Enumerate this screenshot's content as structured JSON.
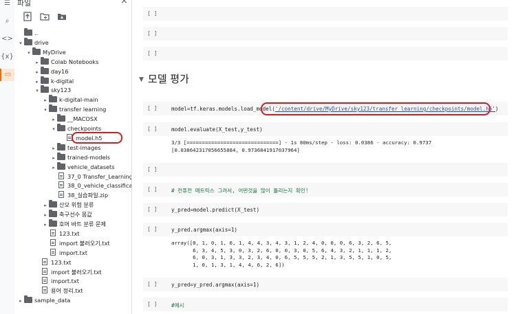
{
  "panel": {
    "title": "파일",
    "close_glyph": "×",
    "toolbar": [
      "upload-file-icon",
      "new-folder-icon",
      "mount-drive-icon"
    ]
  },
  "rail": {
    "icons": [
      {
        "name": "menu-icon",
        "glyph": "☰"
      },
      {
        "name": "search-icon",
        "glyph": "⌕"
      },
      {
        "name": "code-icon",
        "glyph": "<>"
      },
      {
        "name": "variables-icon",
        "glyph": "{x}"
      },
      {
        "name": "files-icon",
        "glyph": "▭"
      }
    ]
  },
  "tree": [
    {
      "label": "..",
      "depth": 0,
      "kind": "up"
    },
    {
      "label": "drive",
      "depth": 0,
      "kind": "folder",
      "open": true
    },
    {
      "label": "MyDrive",
      "depth": 1,
      "kind": "folder",
      "open": true
    },
    {
      "label": "Colab Notebooks",
      "depth": 2,
      "kind": "folder",
      "open": false
    },
    {
      "label": "day16",
      "depth": 2,
      "kind": "folder",
      "open": false
    },
    {
      "label": "k-digital",
      "depth": 2,
      "kind": "folder",
      "open": false
    },
    {
      "label": "sky123",
      "depth": 2,
      "kind": "folder",
      "open": true
    },
    {
      "label": "k-digital-main",
      "depth": 3,
      "kind": "folder",
      "open": false
    },
    {
      "label": "transfer learning",
      "depth": 3,
      "kind": "folder",
      "open": true
    },
    {
      "label": "__MACOSX",
      "depth": 4,
      "kind": "folder",
      "open": false
    },
    {
      "label": "checkpoints",
      "depth": 4,
      "kind": "folder",
      "open": true
    },
    {
      "label": "model.h5",
      "depth": 5,
      "kind": "file"
    },
    {
      "label": "test-images",
      "depth": 4,
      "kind": "folder",
      "open": false
    },
    {
      "label": "trained-models",
      "depth": 4,
      "kind": "folder",
      "open": false
    },
    {
      "label": "vehicle_datasets",
      "depth": 4,
      "kind": "folder",
      "open": false
    },
    {
      "label": "37_0 Transfer_Learning...",
      "depth": 4,
      "kind": "file"
    },
    {
      "label": "38_0_vehicle_classifica...",
      "depth": 4,
      "kind": "file"
    },
    {
      "label": "38_실습파일.zip",
      "depth": 4,
      "kind": "file"
    },
    {
      "label": "산모 위험 분류",
      "depth": 3,
      "kind": "folder",
      "open": false
    },
    {
      "label": "축구선수 몸값",
      "depth": 3,
      "kind": "folder",
      "open": false
    },
    {
      "label": "호머 바트 분류 문제",
      "depth": 3,
      "kind": "folder",
      "open": false
    },
    {
      "label": "123.txt",
      "depth": 3,
      "kind": "file"
    },
    {
      "label": "import 불러오기.txt",
      "depth": 3,
      "kind": "file"
    },
    {
      "label": "import.txt",
      "depth": 3,
      "kind": "file"
    },
    {
      "label": "123.txt",
      "depth": 2,
      "kind": "file"
    },
    {
      "label": "import 불러오기.txt",
      "depth": 2,
      "kind": "file"
    },
    {
      "label": "import.txt",
      "depth": 2,
      "kind": "file"
    },
    {
      "label": "용어 정리.txt",
      "depth": 2,
      "kind": "file"
    },
    {
      "label": "sample_data",
      "depth": 0,
      "kind": "folder",
      "open": false
    }
  ],
  "notebook": {
    "section_title": "모델 평가",
    "bracket": "[ ]",
    "cells": [
      {
        "code": "",
        "output": ""
      },
      {
        "code": "",
        "output": ""
      },
      {
        "code": "",
        "output": ""
      },
      {
        "code_prefix": "model=tf.keras.models.load_model(",
        "code_path": "'/content/drive/MyDrive/sky123/transfer learning/checkpoints/model.h5'",
        "code_suffix": ")",
        "output": ""
      },
      {
        "code": "model.evaluate(X_test,y_test)",
        "output": "3/3 [==============================] - 1s 80ms/step - loss: 0.0386 - accuracy: 0.9737\n[0.038642317056655884, 0.9736841917037964]"
      },
      {
        "code": "",
        "output": ""
      },
      {
        "code": "# 컨퓨전 매트릭스 그려서, 어떤것을 많이 틀리는지 확인!",
        "comment": true,
        "output": ""
      },
      {
        "code": "y_pred=model.predict(X_test)",
        "output": ""
      },
      {
        "code": "y_pred.argmax(axis=1)",
        "output": "array([0, 1, 0, 1, 6, 1, 4, 4, 3, 4, 3, 1, 2, 4, 0, 0, 0, 6, 3, 2, 6, 5,\n       6, 3, 4, 5, 3, 0, 3, 2, 6, 0, 0, 3, 0, 5, 6, 4, 3, 2, 1, 1, 1, 2,\n       6, 0, 3, 1, 3, 3, 2, 3, 4, 0, 6, 5, 5, 5, 2, 1, 3, 5, 5, 1, 0, 5,\n       1, 0, 1, 3, 1, 4, 4, 6, 2, 6])"
      },
      {
        "code": "y_pred=y_pred.argmax(axis=1)",
        "output": ""
      },
      {
        "code": "#예시",
        "comment": true,
        "output": ""
      }
    ]
  },
  "colors": {
    "accent": "#e8710a",
    "highlight": "#d81b1b",
    "comment": "#0f7a3a"
  }
}
